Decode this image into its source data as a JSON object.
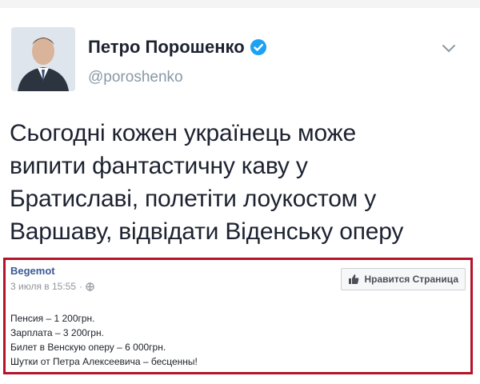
{
  "tweet": {
    "display_name": "Петро Порошенко",
    "handle": "@poroshenko",
    "text_lines": [
      "Сьогодні кожен українець може",
      "випити фантастичну каву у",
      "Братиславі, полетіти лоукостом у",
      "Варшаву, відвідати Віденську оперу"
    ],
    "icons": {
      "verified": "verified-badge-icon",
      "menu": "chevron-down-icon"
    },
    "colors": {
      "verified": "#1da1f2",
      "handle": "#8899a6"
    }
  },
  "fb_post": {
    "page_name": "Begemot",
    "timestamp": "3 июля в 15:55",
    "separator": "·",
    "like_button_label": "Нравится Страница",
    "lines": [
      "Пенсия – 1 200грн.",
      "Зарплата – 3 200грн.",
      "Билет в Венскую оперу – 6 000грн.",
      "Шутки от Петра Алексеевича – бесценны!"
    ],
    "colors": {
      "border": "#b3142a",
      "page_name": "#3b5998"
    }
  }
}
